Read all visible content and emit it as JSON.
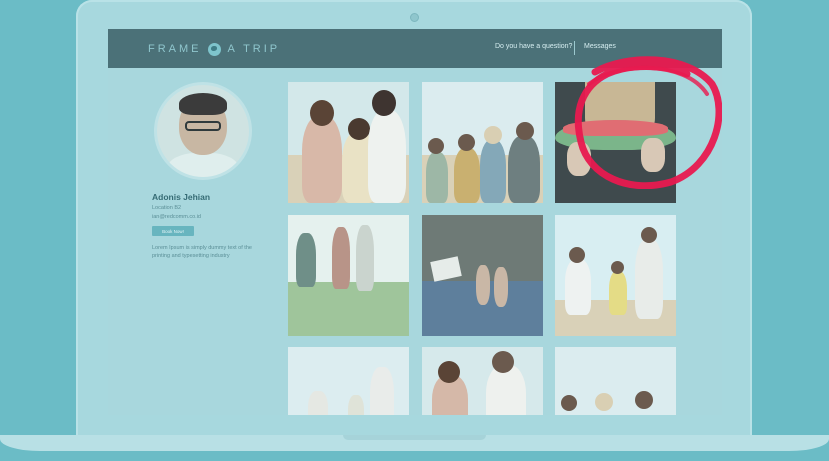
{
  "navbar": {
    "brand_left": "FRAME",
    "brand_right": "A TRIP",
    "question_link": "Do you have a question?",
    "messages_link": "Messages"
  },
  "profile": {
    "name": "Adonis Jehian",
    "location": "Location B2",
    "email": "ian@redcomm.co.id",
    "book_button": "Book Now!",
    "bio": "Lorem Ipsum is simply dummy text of the printing and typesetting industry"
  },
  "gallery": {
    "photos": [
      {
        "name": "family-hug-photo"
      },
      {
        "name": "friends-guitar-photo"
      },
      {
        "name": "watermelon-photo"
      },
      {
        "name": "running-field-photo"
      },
      {
        "name": "feet-polaroid-photo"
      },
      {
        "name": "jumping-family-photo"
      },
      {
        "name": "beach-jump-photo"
      },
      {
        "name": "family-smile-photo"
      },
      {
        "name": "beach-friends-photo"
      }
    ]
  },
  "colors": {
    "background": "#6bbcc6",
    "navbar": "#4b7178",
    "accent": "#68b5bf",
    "annotation": "#e8194f"
  }
}
